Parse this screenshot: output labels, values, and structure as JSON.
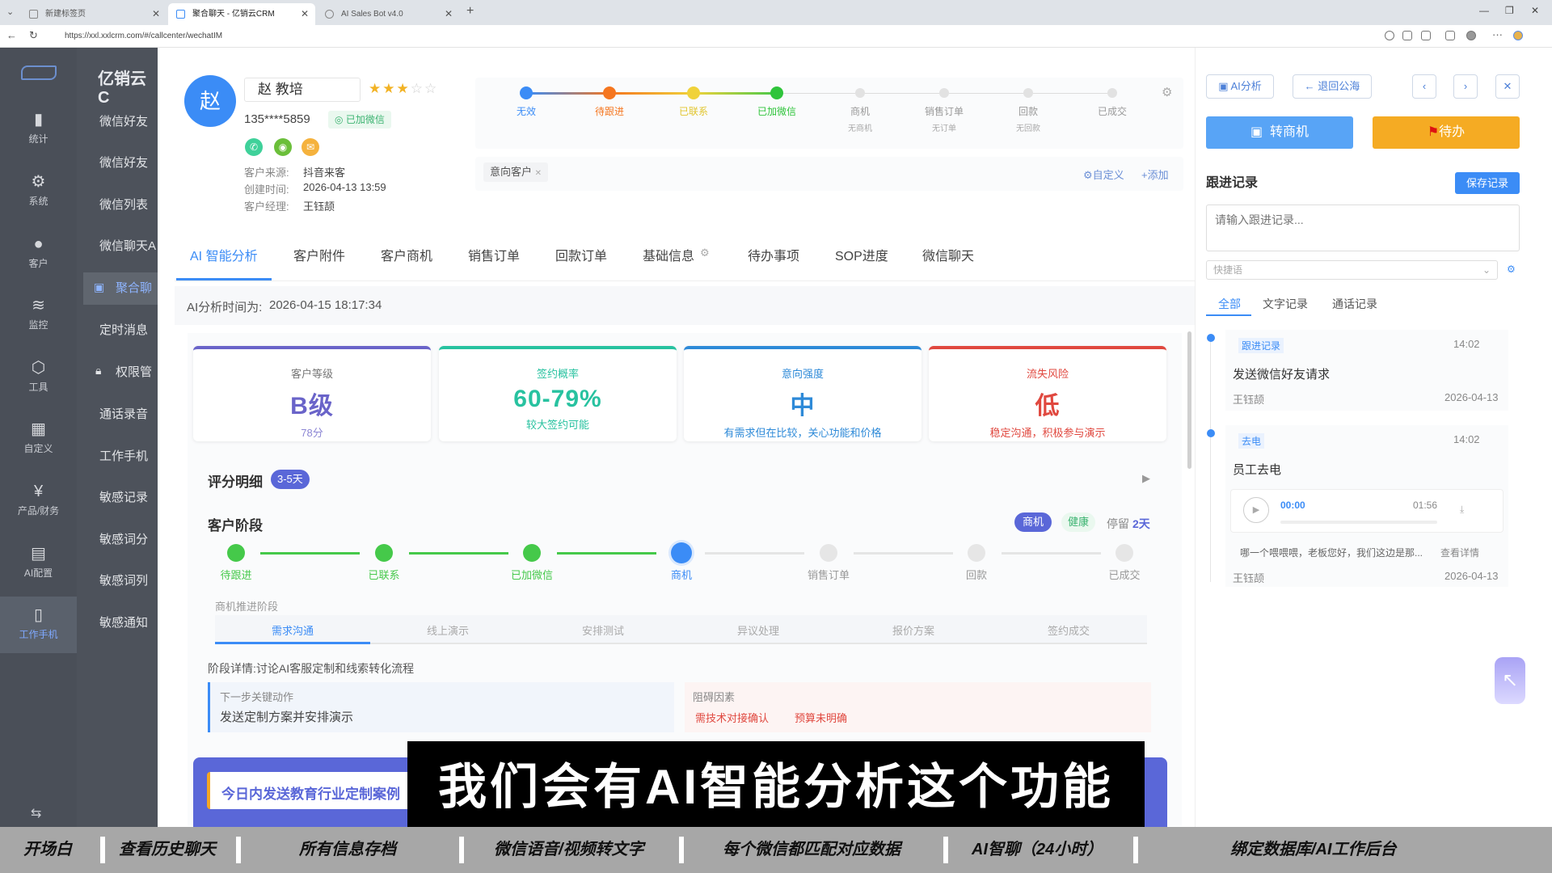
{
  "browser": {
    "tabs": [
      {
        "title": "新建标签页"
      },
      {
        "title": "聚合聊天 - 亿销云CRM"
      },
      {
        "title": "AI Sales Bot v4.0"
      }
    ],
    "url": "https://xxl.xxlcrm.com/#/callcenter/wechatIM"
  },
  "sidebar": {
    "items": [
      {
        "label": "统计",
        "icon": "bar-chart-icon"
      },
      {
        "label": "系统",
        "icon": "gear-icon"
      },
      {
        "label": "客户",
        "icon": "user-icon"
      },
      {
        "label": "监控",
        "icon": "layers-icon"
      },
      {
        "label": "工具",
        "icon": "cube-icon"
      },
      {
        "label": "自定义",
        "icon": "grid-icon"
      },
      {
        "label": "产品/财务",
        "icon": "yen-icon"
      },
      {
        "label": "AI配置",
        "icon": "doc-icon"
      },
      {
        "label": "工作手机",
        "icon": "phone-icon"
      }
    ],
    "brand": "亿销云C"
  },
  "submenu": {
    "items": [
      "微信好友",
      "微信好友",
      "微信列表",
      "微信聊天A",
      "聚合聊",
      "定时消息",
      "权限管",
      "通话录音",
      "工作手机",
      "敏感记录",
      "敏感词分",
      "敏感词列",
      "敏感通知"
    ]
  },
  "customer": {
    "avatar_char": "赵",
    "name": "赵 教培",
    "phone": "135****5859",
    "wechat_tag": "已加微信",
    "source_label": "客户来源:",
    "source": "抖音来客",
    "created_label": "创建时间:",
    "created": "2026-04-13 13:59",
    "manager_label": "客户经理:",
    "manager": "王钰颉",
    "stars": 3
  },
  "pipeline": {
    "stages": [
      {
        "label": "无效",
        "sub": ""
      },
      {
        "label": "待跟进",
        "sub": ""
      },
      {
        "label": "已联系",
        "sub": ""
      },
      {
        "label": "已加微信",
        "sub": ""
      },
      {
        "label": "商机",
        "sub": "无商机"
      },
      {
        "label": "销售订单",
        "sub": "无订单"
      },
      {
        "label": "回款",
        "sub": "无回款"
      },
      {
        "label": "已成交",
        "sub": ""
      }
    ],
    "tag": "意向客户",
    "custom_link": "自定义",
    "add_link": "+添加"
  },
  "tabs": [
    "AI 智能分析",
    "客户附件",
    "客户商机",
    "销售订单",
    "回款订单",
    "基础信息",
    "待办事项",
    "SOP进度",
    "微信聊天"
  ],
  "analysis": {
    "time_label": "AI分析时间为:",
    "time": "2026-04-15 18:17:34",
    "metrics": [
      {
        "title": "客户等级",
        "value": "B级",
        "sub": "78分",
        "color": "#6a64c9"
      },
      {
        "title": "签约概率",
        "value": "60-79%",
        "sub": "较大签约可能",
        "color": "#28c2a0"
      },
      {
        "title": "意向强度",
        "value": "中",
        "sub": "有需求但在比较，关心功能和价格",
        "color": "#2e8ad8"
      },
      {
        "title": "流失风险",
        "value": "低",
        "sub": "稳定沟通，积极参与演示",
        "color": "#e0483f"
      }
    ],
    "score_title": "评分明细",
    "score_badge": "3-5天",
    "stage_title": "客户阶段",
    "stage_badges": {
      "biz": "商机",
      "health": "健康",
      "stay_label": "停留",
      "stay_value": "2天"
    },
    "steps": [
      "待跟进",
      "已联系",
      "已加微信",
      "商机",
      "销售订单",
      "回款",
      "已成交"
    ],
    "biz_stage_label": "商机推进阶段",
    "sub_steps": [
      "需求沟通",
      "线上演示",
      "安排测试",
      "异议处理",
      "报价方案",
      "签约成交"
    ],
    "stage_detail_label": "阶段详情:",
    "stage_detail": "讨论AI客服定制和线索转化流程",
    "next_label": "下一步关键动作",
    "next_value": "发送定制方案并安排演示",
    "block_label": "阻碍因素",
    "block_tags": [
      "需技术对接确认",
      "预算未明确"
    ],
    "banner": "今日内发送教育行业定制案例"
  },
  "right": {
    "ai_btn": "AI分析",
    "back_btn": "退回公海",
    "convert_btn": "转商机",
    "todo_btn": "待办",
    "follow_title": "跟进记录",
    "save_btn": "保存记录",
    "input_placeholder": "请输入跟进记录...",
    "quick_placeholder": "快捷语",
    "rtabs": [
      "全部",
      "文字记录",
      "通话记录"
    ],
    "records": [
      {
        "type": "跟进记录",
        "time": "14:02",
        "content": "发送微信好友请求",
        "user": "王钰颉",
        "date": "2026-04-13"
      },
      {
        "type": "去电",
        "time": "14:02",
        "content": "员工去电",
        "audio_start": "00:00",
        "audio_end": "01:56",
        "transcript": "哪一个喂喂喂，老板您好，我们这边是那...",
        "detail_link": "查看详情",
        "user": "王钰颉",
        "date": "2026-04-13"
      }
    ]
  },
  "caption": "我们会有AI智能分析这个功能",
  "strip": [
    "开场白",
    "查看历史聊天",
    "所有信息存档",
    "微信语音/视频转文字",
    "每个微信都匹配对应数据",
    "AI智聊（24小时）",
    "绑定数据库/AI工作后台"
  ]
}
